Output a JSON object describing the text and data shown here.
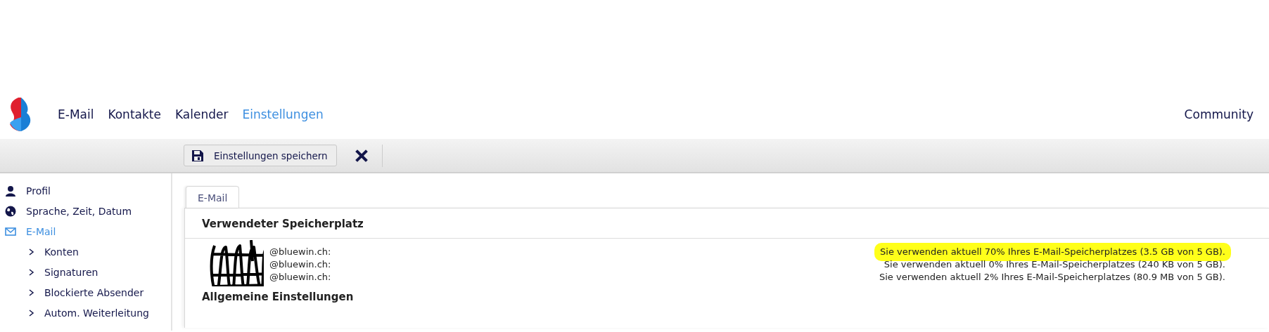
{
  "nav": {
    "items": [
      {
        "label": "E-Mail",
        "selected": false
      },
      {
        "label": "Kontakte",
        "selected": false
      },
      {
        "label": "Kalender",
        "selected": false
      },
      {
        "label": "Einstellungen",
        "selected": true
      }
    ],
    "right_link": "Community"
  },
  "toolbar": {
    "save_button": "Einstellungen speichern"
  },
  "sidebar": {
    "items": [
      {
        "label": "Profil",
        "selected": false
      },
      {
        "label": "Sprache, Zeit, Datum",
        "selected": false
      },
      {
        "label": "E-Mail",
        "selected": true,
        "children": [
          {
            "label": "Konten",
            "selected": false
          },
          {
            "label": "Signaturen",
            "selected": false
          },
          {
            "label": "Blockierte Absender",
            "selected": false
          },
          {
            "label": "Autom. Weiterleitung",
            "selected": false
          }
        ]
      }
    ]
  },
  "tabs": [
    {
      "label": "E-Mail",
      "selected": true
    }
  ],
  "storage": {
    "heading": "Verwendeter Speicherplatz",
    "redacted": true,
    "rows": [
      {
        "account": "@bluewin.ch:",
        "usage": "Sie verwenden aktuell 70% Ihres E-Mail-Speicherplatzes (3.5 GB von 5 GB).",
        "highlighted": true
      },
      {
        "account": "@bluewin.ch:",
        "usage": "Sie verwenden aktuell 0% Ihres E-Mail-Speicherplatzes (240 KB von 5 GB).",
        "highlighted": false
      },
      {
        "account": "@bluewin.ch:",
        "usage": "Sie verwenden aktuell 2% Ihres E-Mail-Speicherplatzes (80.9 MB von 5 GB).",
        "highlighted": false
      }
    ]
  },
  "next_heading": "Allgemeine Einstellungen"
}
